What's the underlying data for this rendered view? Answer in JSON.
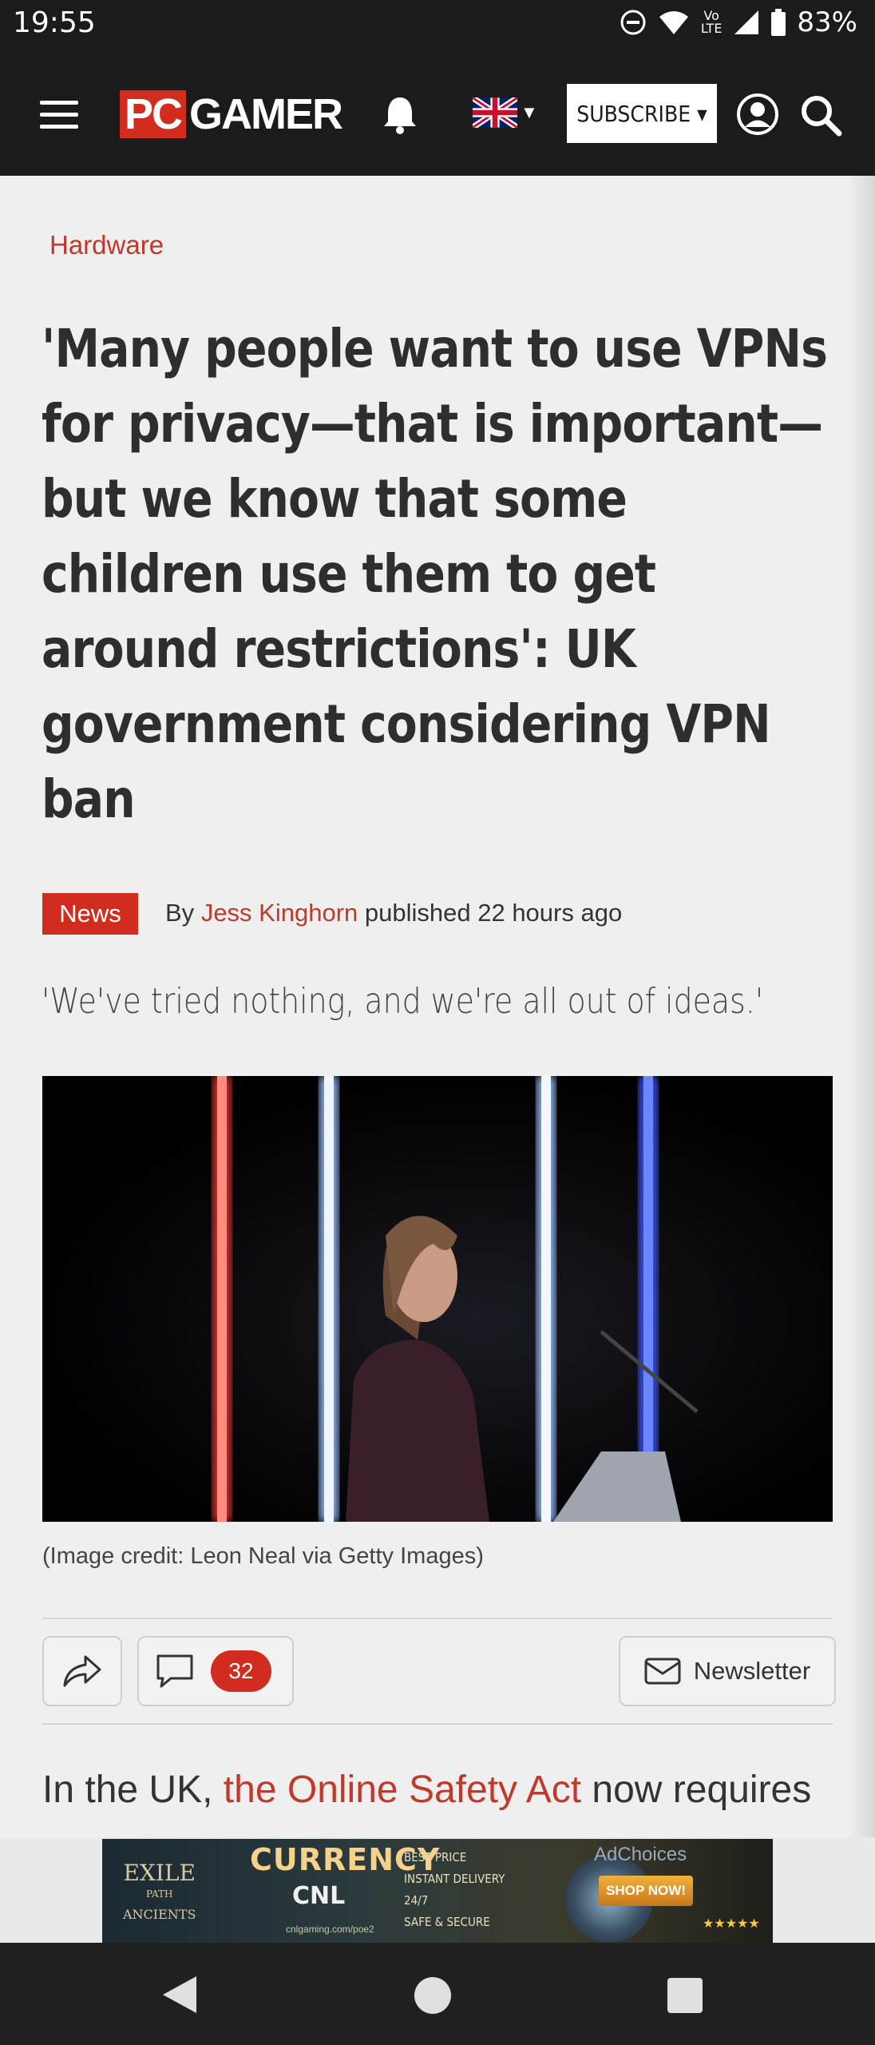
{
  "status": {
    "time": "19:55",
    "battery": "83%",
    "network": "LTE"
  },
  "header": {
    "logo_pc": "PC",
    "logo_gamer": "GAMER",
    "subscribe_label": "SUBSCRIBE ▾"
  },
  "article": {
    "category": "Hardware",
    "headline_lines": [
      "'Many people want to use VPNs",
      "for privacy—that is important—",
      "but we know that some",
      "children use them to get",
      "around restrictions': UK",
      "government considering VPN",
      "ban"
    ],
    "badge": "News",
    "by": "By",
    "author": "Jess Kinghorn",
    "published": "published 22 hours ago",
    "strapline": "'We've tried nothing, and we're all out of ideas.'",
    "image_credit": "(Image credit: Leon Neal via Getty Images)",
    "comment_count": "32",
    "newsletter_label": "Newsletter",
    "body_start": "In the UK,",
    "body_link": "the Online Safety Act",
    "body_end": "now requires"
  },
  "ad": {
    "exile": "EXILE",
    "path": "PATH",
    "ancients": "ANCIENTS",
    "headline": "CURRENCY",
    "brand": "CNL",
    "features": [
      "BEST PRICE",
      "INSTANT DELIVERY",
      "24/7",
      "SAFE & SECURE"
    ],
    "cta": "SHOP NOW!",
    "url": "cnlgaming.com/poe2",
    "adchoices": "AdChoices"
  },
  "colors": {
    "brand_red": "#d22c1f",
    "link_red": "#c0392b",
    "header_bg": "#1b1b1b"
  }
}
